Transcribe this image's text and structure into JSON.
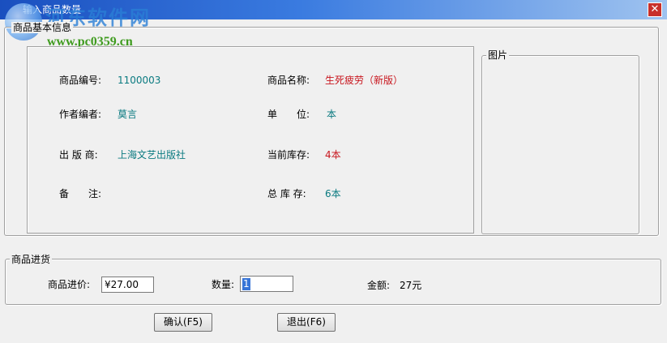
{
  "window": {
    "title": "输入商品数量",
    "close_glyph": "✕"
  },
  "watermark": {
    "line1": "河东软件网",
    "line2": "www.pc0359.cn"
  },
  "info": {
    "group_title": "商品基本信息",
    "code_label": "商品编号:",
    "code_value": "1100003",
    "name_label": "商品名称:",
    "name_value": "生死疲劳（新版）",
    "author_label": "作者编者:",
    "author_value": "莫言",
    "unit_label": "单　　位:",
    "unit_value": "本",
    "publisher_label": "出 版 商:",
    "publisher_value": "上海文艺出版社",
    "current_stock_label": "当前库存:",
    "current_stock_value": "4本",
    "note_label": "备　　注:",
    "note_value": "",
    "total_stock_label": "总 库 存:",
    "total_stock_value": "6本"
  },
  "picture": {
    "group_title": "图片"
  },
  "purchase": {
    "group_title": "商品进货",
    "price_label": "商品进价:",
    "price_value": "¥27.00",
    "qty_label": "数量:",
    "qty_value": "1",
    "amount_label": "金额:",
    "amount_value": "27元"
  },
  "buttons": {
    "confirm_label": "确认(F5)",
    "exit_label": "退出(F6)"
  },
  "colors": {
    "value_teal": "#0a7a80",
    "value_red": "#c8161e",
    "title_bar": "#1a4fbf"
  }
}
